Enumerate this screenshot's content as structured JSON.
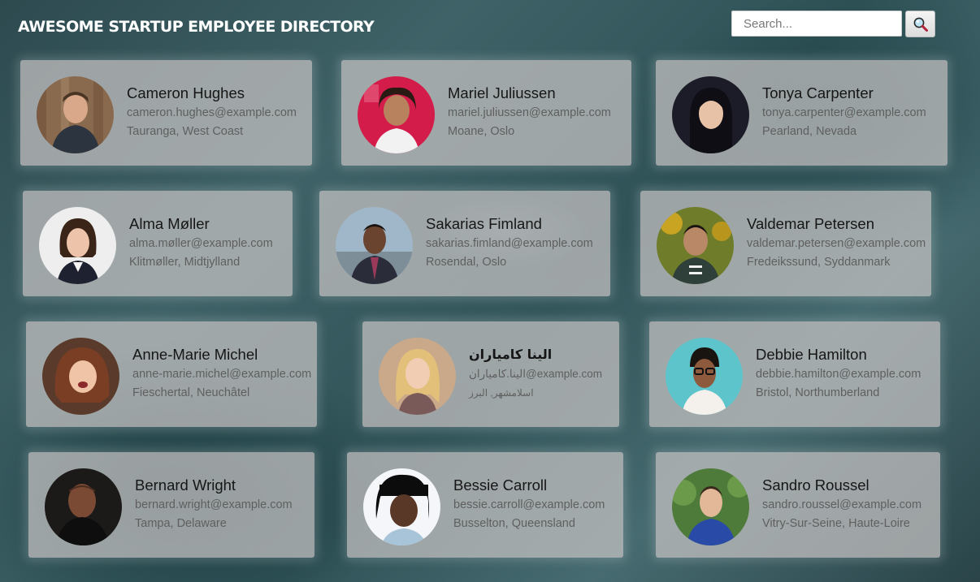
{
  "header": {
    "title": "AWESOME STARTUP EMPLOYEE DIRECTORY",
    "search_placeholder": "Search...",
    "search_icon": "magnifier-icon"
  },
  "employees": [
    {
      "name": "Cameron Hughes",
      "email": "cameron.hughes@example.com",
      "location": "Tauranga, West Coast"
    },
    {
      "name": "Mariel Juliussen",
      "email": "mariel.juliussen@example.com",
      "location": "Moane, Oslo"
    },
    {
      "name": "Tonya Carpenter",
      "email": "tonya.carpenter@example.com",
      "location": "Pearland, Nevada"
    },
    {
      "name": "Alma Møller",
      "email": "alma.møller@example.com",
      "location": "Klitmøller, Midtjylland"
    },
    {
      "name": "Sakarias Fimland",
      "email": "sakarias.fimland@example.com",
      "location": "Rosendal, Oslo"
    },
    {
      "name": "Valdemar Petersen",
      "email": "valdemar.petersen@example.com",
      "location": "Fredeikssund, Syddanmark"
    },
    {
      "name": "Anne-Marie Michel",
      "email": "anne-marie.michel@example.com",
      "location": "Fieschertal, Neuchâtel"
    },
    {
      "name": "الینا کامیاران",
      "email": "الینا.کامیاران@example.com",
      "location": "اسلامشهر, البرز"
    },
    {
      "name": "Debbie Hamilton",
      "email": "debbie.hamilton@example.com",
      "location": "Bristol, Northumberland"
    },
    {
      "name": "Bernard Wright",
      "email": "bernard.wright@example.com",
      "location": "Tampa, Delaware"
    },
    {
      "name": "Bessie Carroll",
      "email": "bessie.carroll@example.com",
      "location": "Busselton, Queensland"
    },
    {
      "name": "Sandro Roussel",
      "email": "sandro.roussel@example.com",
      "location": "Vitry-Sur-Seine, Haute-Loire"
    }
  ]
}
